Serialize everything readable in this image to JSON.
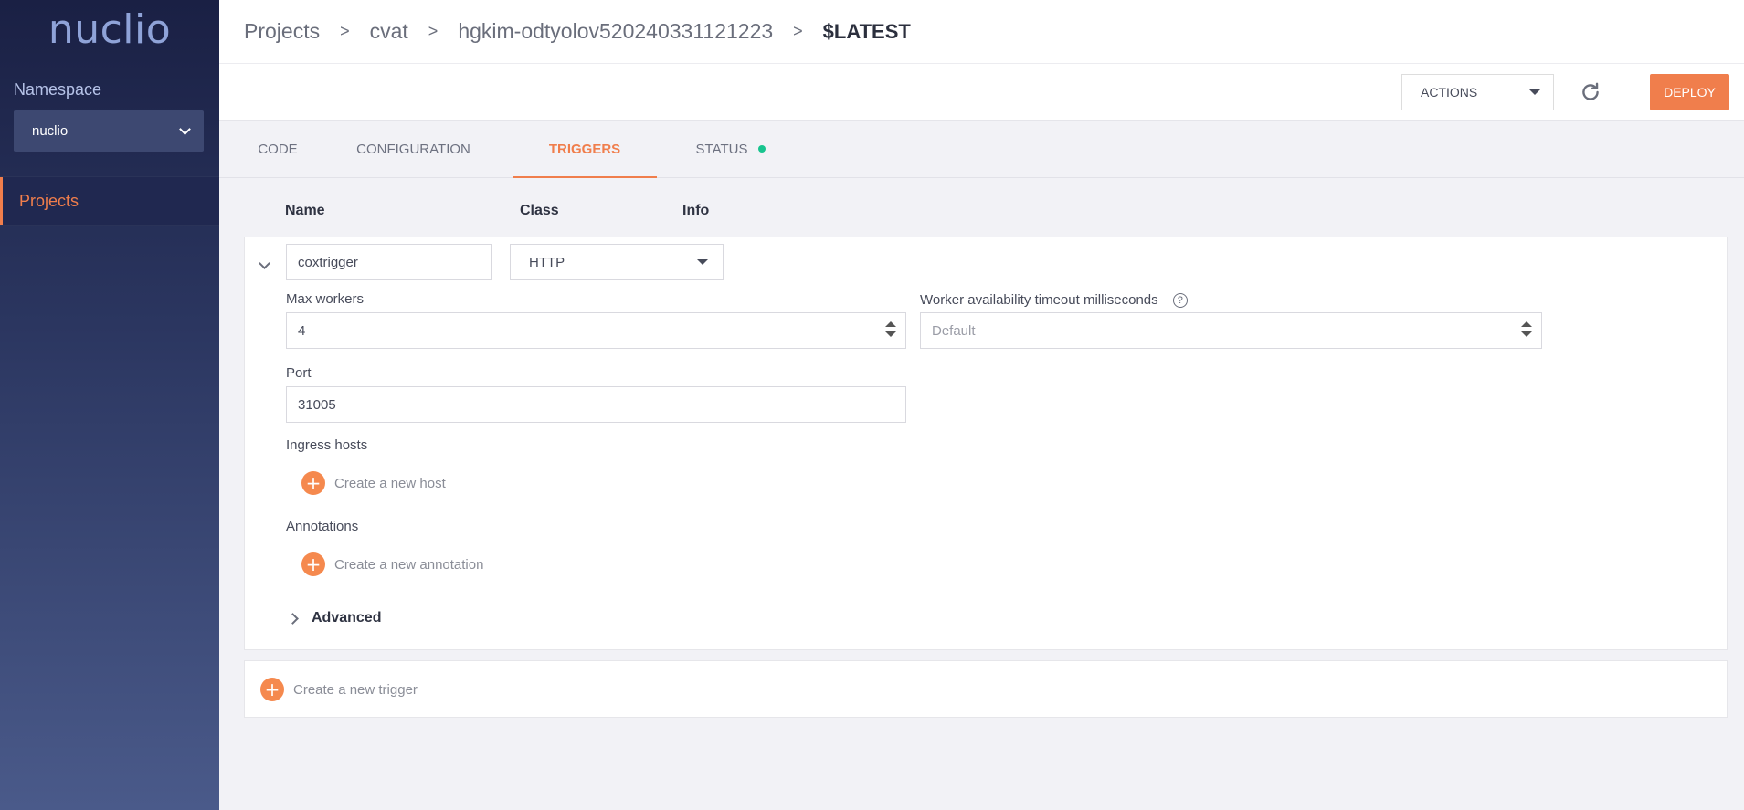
{
  "sidebar": {
    "logo": "nuclio",
    "namespace_label": "Namespace",
    "namespace_value": "nuclio",
    "nav": [
      {
        "label": "Projects"
      }
    ]
  },
  "breadcrumb": {
    "items": [
      "Projects",
      "cvat",
      "hgkim-odtyolov520240331121223"
    ],
    "current": "$LATEST",
    "separator": ">"
  },
  "toolbar": {
    "actions_label": "ACTIONS",
    "deploy_label": "DEPLOY"
  },
  "tabs": [
    {
      "label": "CODE"
    },
    {
      "label": "CONFIGURATION"
    },
    {
      "label": "TRIGGERS",
      "active": true
    },
    {
      "label": "STATUS"
    }
  ],
  "table": {
    "headers": [
      "Name",
      "Class",
      "Info"
    ]
  },
  "trigger": {
    "name": "coxtrigger",
    "class": "HTTP",
    "max_workers_label": "Max workers",
    "max_workers": "4",
    "worker_timeout_label": "Worker availability timeout milliseconds",
    "worker_timeout_placeholder": "Default",
    "port_label": "Port",
    "port": "31005",
    "ingress_label": "Ingress hosts",
    "create_host": "Create a new host",
    "annotations_label": "Annotations",
    "create_annotation": "Create a new annotation",
    "advanced_label": "Advanced"
  },
  "create_trigger": "Create a new trigger",
  "colors": {
    "accent": "#f07e4c",
    "status_ok": "#18c48e",
    "sidebar_top": "#1a2044"
  }
}
